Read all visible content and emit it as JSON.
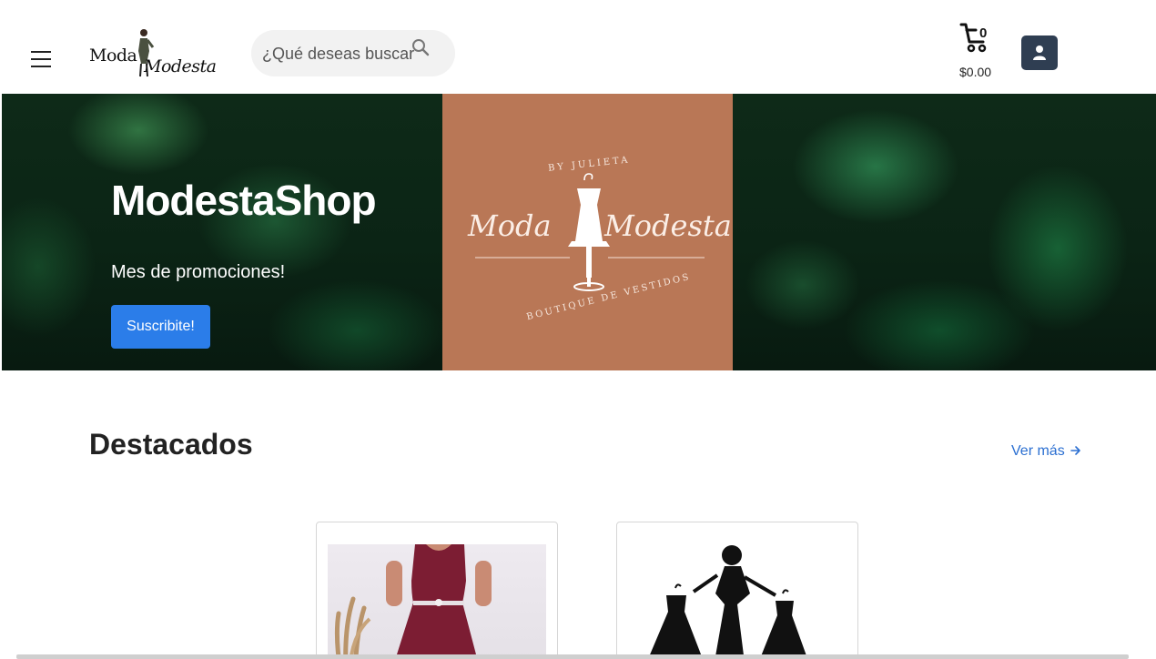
{
  "header": {
    "logo_word1": "Moda",
    "logo_word2": "Modesta",
    "search_placeholder": "¿Qué deseas buscar?",
    "cart_count": "0",
    "cart_total": "$0.00"
  },
  "hero": {
    "title": "ModestaShop",
    "subtitle": "Mes de promociones!",
    "button_label": "Suscribite!",
    "brand_card": {
      "top_text": "BY JULIETA",
      "script_left": "Moda",
      "script_right": "Modesta",
      "bottom_text": "BOUTIQUE DE VESTIDOS",
      "bg_color": "#b97756"
    }
  },
  "featured": {
    "title": "Destacados",
    "more_label": "Ver más"
  },
  "colors": {
    "accent": "#2b7de9",
    "user_button": "#2f3e52",
    "link": "#2b6fd1"
  }
}
